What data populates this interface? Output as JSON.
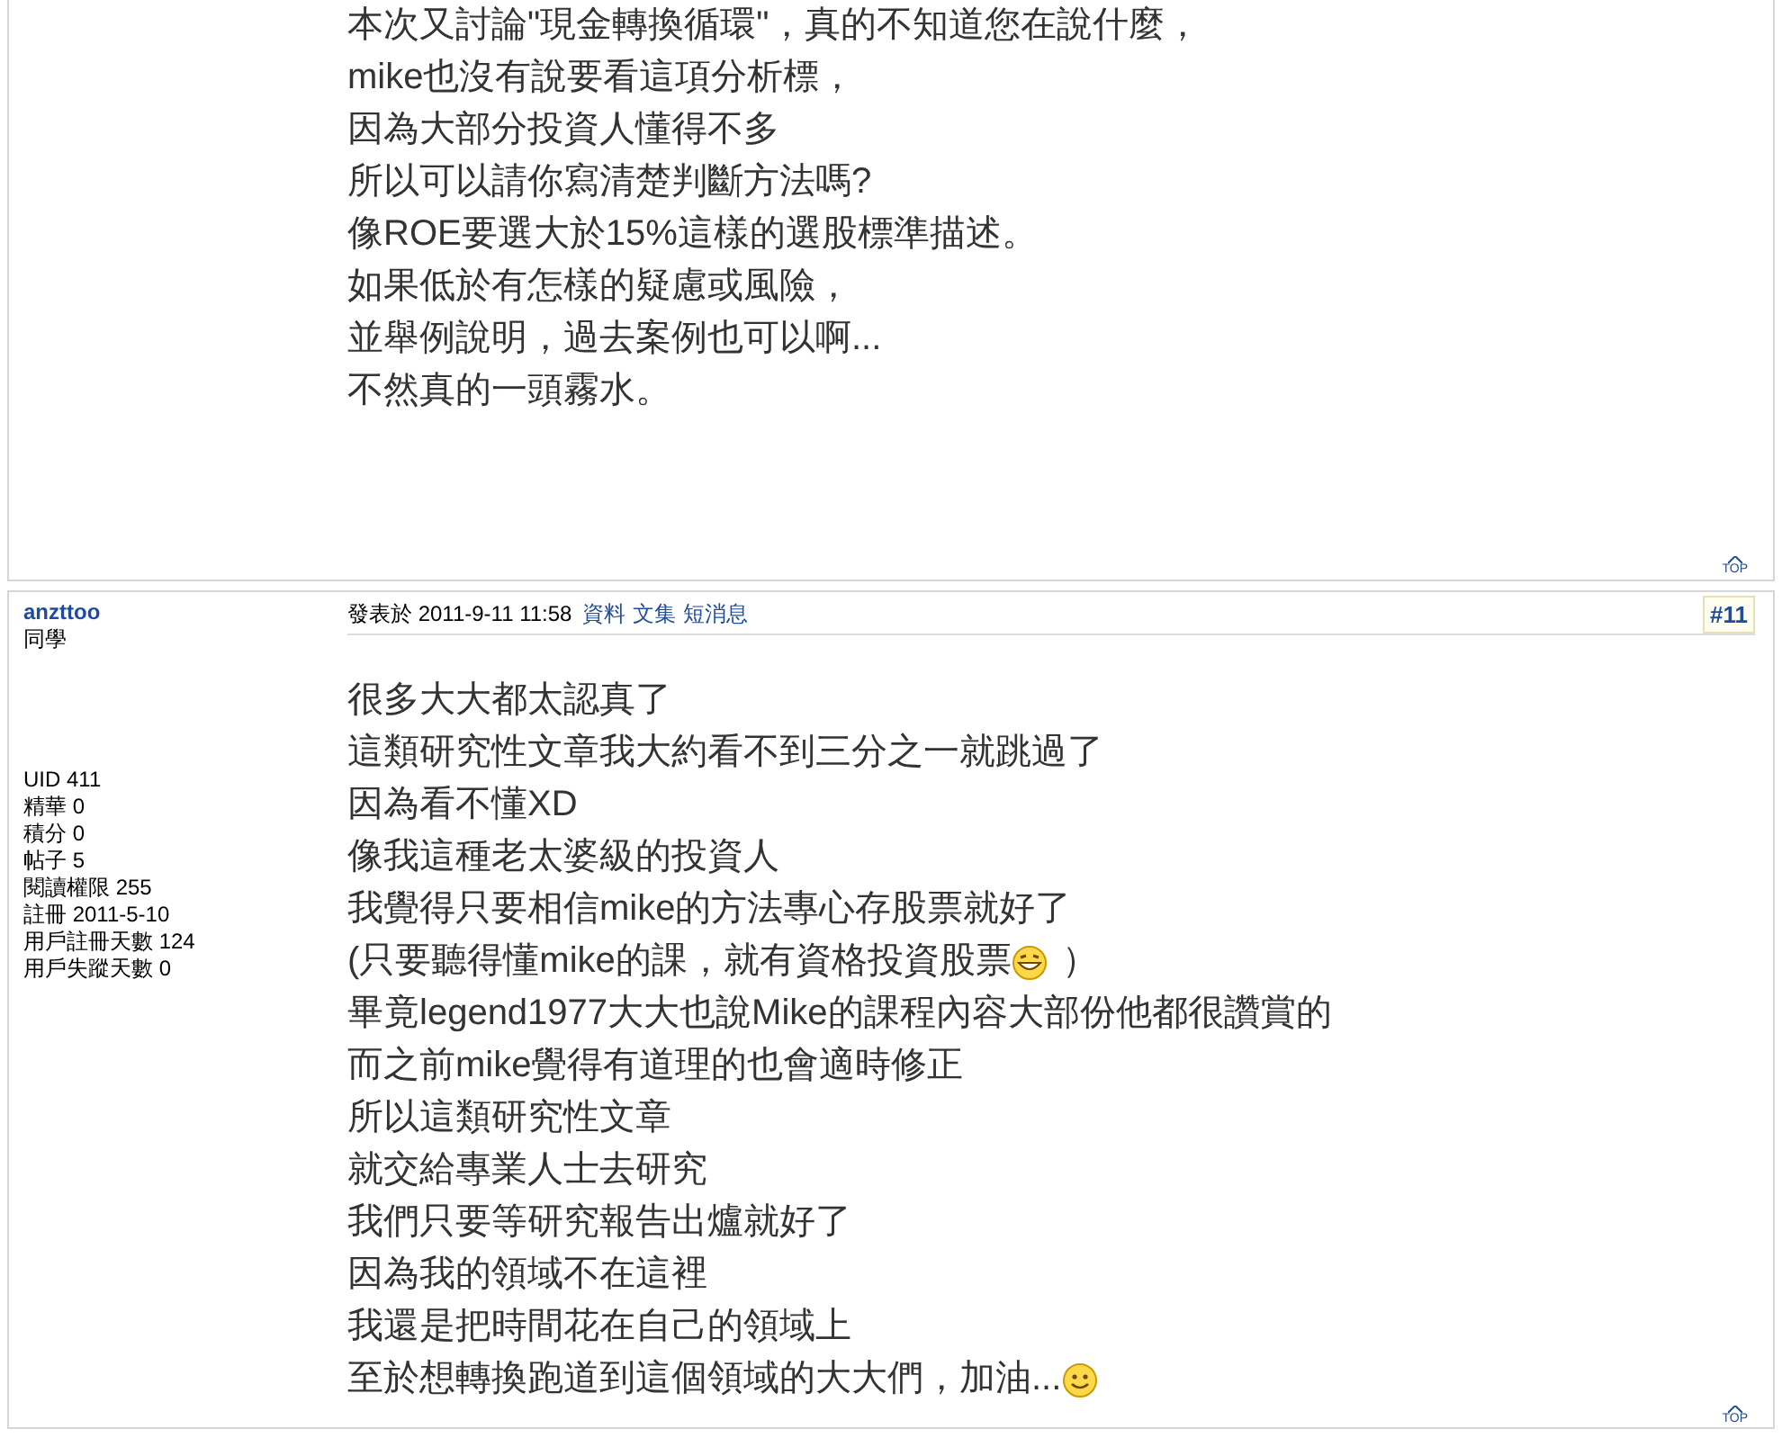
{
  "posts": [
    {
      "lines": [
        {
          "text": "本次又討論\"現金轉換循環\"，真的不知道您在說什麼，"
        },
        {
          "text": "mike也沒有說要看這項分析標，"
        },
        {
          "text": "因為大部分投資人懂得不多"
        },
        {
          "text": "所以可以請你寫清楚判斷方法嗎?"
        },
        {
          "text": "像ROE要選大於15%這樣的選股標準描述。"
        },
        {
          "text": "如果低於有怎樣的疑慮或風險，"
        },
        {
          "text": "並舉例說明，過去案例也可以啊..."
        },
        {
          "text": "不然真的一頭霧水。"
        }
      ],
      "top_link": "TOP"
    },
    {
      "author": {
        "name": "anzttoo",
        "rank": "同學",
        "stats": [
          "UID 411",
          "精華 0",
          "積分 0",
          "帖子 5",
          "閱讀權限 255",
          "註冊 2011-5-10",
          "用戶註冊天數 124",
          "用戶失蹤天數 0"
        ]
      },
      "meta": {
        "posted": "發表於 2011-9-11 11:58",
        "links": [
          "資料",
          "文集",
          "短消息"
        ],
        "floor": "#11"
      },
      "lines": [
        {
          "text": "很多大大都太認真了"
        },
        {
          "text": "這類研究性文章我大約看不到三分之一就跳過了"
        },
        {
          "text": "因為看不懂XD"
        },
        {
          "text": "像我這種老太婆級的投資人"
        },
        {
          "text": "我覺得只要相信mike的方法專心存股票就好了"
        },
        {
          "text": "(只要聽得懂mike的課，就有資格投資股票",
          "kind": "grin",
          "after": "）"
        },
        {
          "text": "畢竟legend1977大大也說Mike的課程內容大部份他都很讚賞的"
        },
        {
          "text": "而之前mike覺得有道理的也會適時修正"
        },
        {
          "text": "所以這類研究性文章"
        },
        {
          "text": "就交給專業人士去研究"
        },
        {
          "text": "我們只要等研究報告出爐就好了"
        },
        {
          "text": "因為我的領域不在這裡"
        },
        {
          "text": "我還是把時間花在自己的領域上"
        },
        {
          "text": "至於想轉換跑道到這個領域的大大們，加油...",
          "kind": "smile"
        }
      ],
      "top_link": "TOP"
    }
  ]
}
